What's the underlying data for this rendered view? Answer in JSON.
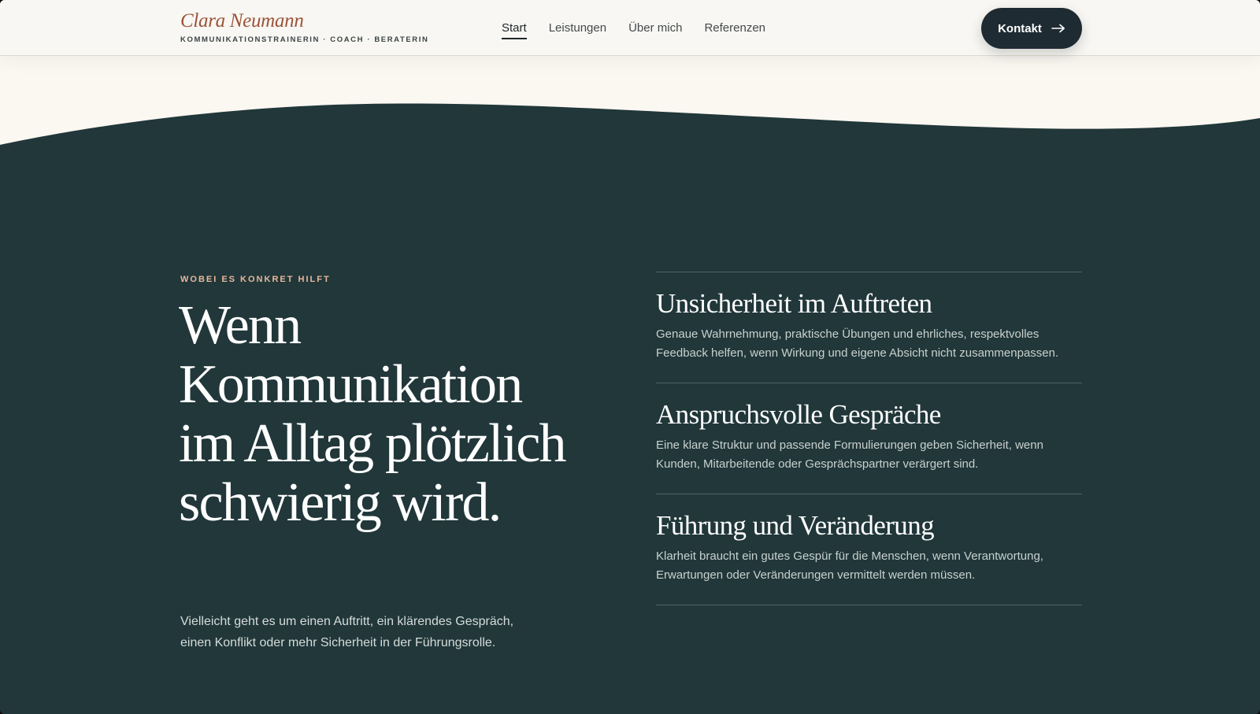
{
  "brand": {
    "name": "Clara Neumann",
    "tagline": "KOMMUNIKATIONSTRAINERIN · COACH · BERATERIN"
  },
  "nav": {
    "items": [
      {
        "label": "Start",
        "active": true
      },
      {
        "label": "Leistungen",
        "active": false
      },
      {
        "label": "Über mich",
        "active": false
      },
      {
        "label": "Referenzen",
        "active": false
      }
    ]
  },
  "cta": {
    "label": "Kontakt",
    "icon": "arrow-right-icon"
  },
  "hero": {
    "eyebrow": "WOBEI ES KONKRET HILFT",
    "headline": "Wenn Kommunikation im Alltag plötzlich schwierig wird.",
    "lede": "Vielleicht geht es um einen Auftritt, ein klärendes Gespräch, einen Konflikt oder mehr Sicherheit in der Führungsrolle."
  },
  "topics": [
    {
      "title": "Unsicherheit im Auftreten",
      "text": "Genaue Wahrnehmung, praktische Übungen und ehrliches, respektvolles Feedback helfen, wenn Wirkung und eigene Absicht nicht zusammenpassen."
    },
    {
      "title": "Anspruchsvolle Gespräche",
      "text": "Eine klare Struktur und passende Formulierungen geben Sicherheit, wenn Kunden, Mitarbeitende oder Gesprächspartner verärgert sind."
    },
    {
      "title": "Führung und Veränderung",
      "text": "Klarheit braucht ein gutes Gespür für die Menschen, wenn Verantwortung, Erwartungen oder Veränderungen vermittelt werden müssen."
    }
  ],
  "colors": {
    "background_dark": "#21373a",
    "background_light": "#fbf7f1",
    "header": "#f8f7f3",
    "brand_accent": "#9c5238",
    "eyebrow": "#e8b89b",
    "cta": "#1e2b33"
  }
}
